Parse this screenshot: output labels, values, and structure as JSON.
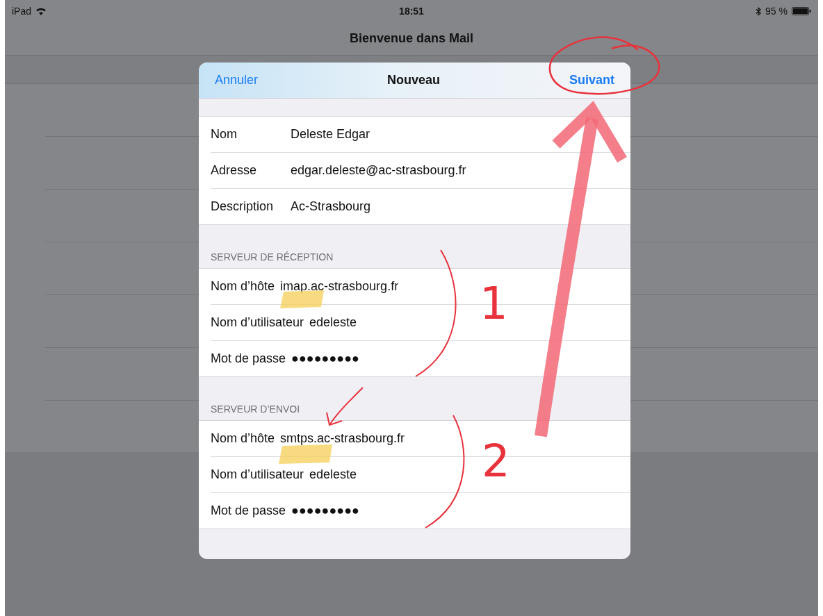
{
  "status_bar": {
    "device": "iPad",
    "time": "18:51",
    "battery": "95 %"
  },
  "nav_title": "Bienvenue dans Mail",
  "dialog": {
    "cancel": "Annuler",
    "title": "Nouveau",
    "next": "Suivant",
    "sections": [
      {
        "kind": "account",
        "rows": [
          {
            "label": "Nom",
            "value": "Deleste Edgar"
          },
          {
            "label": "Adresse",
            "value": "edgar.deleste@ac-strasbourg.fr"
          },
          {
            "label": "Description",
            "value": "Ac-Strasbourg"
          }
        ]
      },
      {
        "kind": "server",
        "header": "SERVEUR DE RÉCEPTION",
        "rows": [
          {
            "label": "Nom d’hôte",
            "value": "imap.ac-strasbourg.fr"
          },
          {
            "label": "Nom d’utilisateur",
            "value": "edeleste"
          },
          {
            "label": "Mot de passe",
            "value": "●●●●●●●●●"
          }
        ]
      },
      {
        "kind": "server",
        "header": "SERVEUR D’ENVOI",
        "rows": [
          {
            "label": "Nom d’hôte",
            "value": "smtps.ac-strasbourg.fr"
          },
          {
            "label": "Nom d’utilisateur",
            "value": "edeleste"
          },
          {
            "label": "Mot de passe",
            "value": "●●●●●●●●●"
          }
        ]
      }
    ]
  },
  "annotations": {
    "numbers": [
      "1",
      "2"
    ]
  }
}
